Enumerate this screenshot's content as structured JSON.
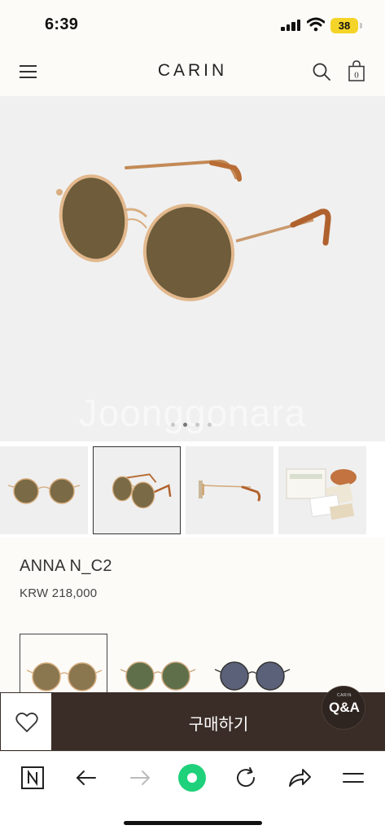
{
  "status_bar": {
    "time": "6:39",
    "battery": "38"
  },
  "header": {
    "brand": "CARIN",
    "cart_count": "0"
  },
  "hero": {
    "watermark": "Joonggonara",
    "slide_count": 4,
    "active_slide": 2
  },
  "product": {
    "name": "ANNA N_C2",
    "price": "KRW 218,000"
  },
  "thumbnails": [
    {
      "name": "front-view",
      "selected": false
    },
    {
      "name": "angle-view",
      "selected": true
    },
    {
      "name": "side-view",
      "selected": false
    },
    {
      "name": "package-view",
      "selected": false
    }
  ],
  "color_options": [
    {
      "lens": "#7a6a45",
      "frame": "#c9a27a",
      "selected": true
    },
    {
      "lens": "#5f6f4a",
      "frame": "#b89870",
      "selected": false
    },
    {
      "lens": "#5b6178",
      "frame": "#333333",
      "selected": false
    }
  ],
  "buy_bar": {
    "buy_label": "구매하기"
  },
  "qa_badge": {
    "brand": "CARIN",
    "label": "Q&A"
  },
  "colors": {
    "buy_bar_bg": "#3a2d27",
    "accent_green": "#1fd17a",
    "battery": "#f5d429"
  }
}
